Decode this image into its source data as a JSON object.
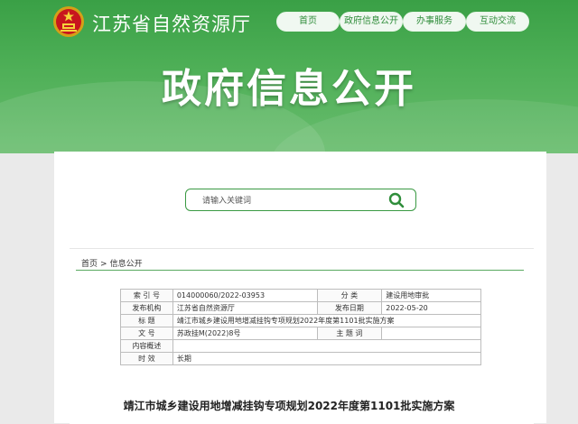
{
  "header": {
    "site_title": "江苏省自然资源厅",
    "nav": [
      "首页",
      "政府信息公开",
      "办事服务",
      "互动交流"
    ],
    "hero_title": "政府信息公开"
  },
  "search": {
    "placeholder": "请输入关键词"
  },
  "breadcrumb": {
    "home": "首页",
    "separator": ">",
    "current": "信息公开"
  },
  "meta": {
    "index_label": "索  引  号",
    "index_value": "014000060/2022-03953",
    "category_label": "分      类",
    "category_value": "建设用地审批",
    "publisher_label": "发布机构",
    "publisher_value": "江苏省自然资源厅",
    "date_label": "发布日期",
    "date_value": "2022-05-20",
    "title_label": "标      题",
    "title_value": "靖江市城乡建设用地增减挂钩专项规划2022年度第1101批实施方案",
    "docno_label": "文      号",
    "docno_value": "苏政挂M(2022)8号",
    "keywords_label": "主  题  词",
    "keywords_value": "",
    "summary_label": "内容概述",
    "summary_value": "",
    "validity_label": "时      效",
    "validity_value": "长期"
  },
  "document": {
    "title": "靖江市城乡建设用地增减挂钩专项规划2022年度第1101批实施方案"
  },
  "colors": {
    "primary_green": "#3aa046",
    "accent_red": "#c8161e"
  }
}
